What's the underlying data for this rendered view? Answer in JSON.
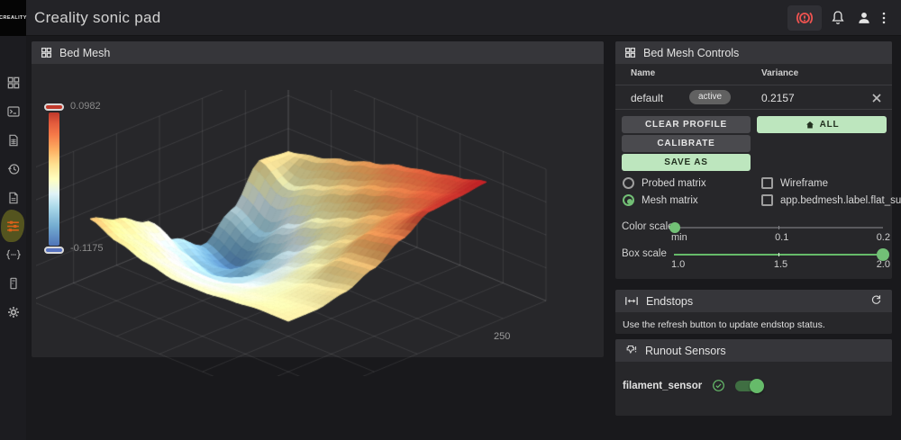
{
  "topbar": {
    "logo_text": "CREALITY",
    "title": "Creality sonic pad",
    "icons": [
      "emergency-stop",
      "notifications-bell",
      "user-account",
      "overflow-menu"
    ]
  },
  "sidebar": {
    "items": [
      {
        "icon": "dashboard-icon"
      },
      {
        "icon": "console-icon"
      },
      {
        "icon": "gcode-files-icon"
      },
      {
        "icon": "history-icon"
      },
      {
        "icon": "configuration-icon"
      },
      {
        "icon": "tune-icon",
        "selected": true
      },
      {
        "icon": "macros-icon"
      },
      {
        "icon": "machine-icon"
      },
      {
        "icon": "settings-gear-icon"
      }
    ]
  },
  "bed_mesh": {
    "title": "Bed Mesh",
    "colorbar_max": "0.0982",
    "colorbar_min": "-0.1175",
    "x_tick": "250"
  },
  "controls": {
    "title": "Bed Mesh Controls",
    "table": {
      "name_header": "Name",
      "variance_header": "Variance",
      "row": {
        "name": "default",
        "badge": "active",
        "variance": "0.2157",
        "close_icon": "close-x"
      }
    },
    "buttons": {
      "clear_profile": "CLEAR PROFILE",
      "all": "ALL",
      "calibrate": "CALIBRATE",
      "save_as": "SAVE AS"
    },
    "radios": [
      {
        "label": "Probed matrix",
        "selected": false
      },
      {
        "label": "Mesh matrix",
        "selected": true
      }
    ],
    "checkboxes": [
      {
        "label": "Wireframe",
        "checked": false
      },
      {
        "label": "app.bedmesh.label.flat_surface",
        "checked": false
      }
    ],
    "sliders": [
      {
        "label": "Color scale",
        "ticks": [
          "min",
          "0.1",
          "0.2"
        ],
        "thumb_position": "left"
      },
      {
        "label": "Box scale",
        "ticks": [
          "1.0",
          "1.5",
          "2.0"
        ],
        "thumb_position": "right"
      }
    ]
  },
  "endstops": {
    "title": "Endstops",
    "message": "Use the refresh button to update endstop status."
  },
  "runout": {
    "title": "Runout Sensors",
    "sensor_name": "filament_sensor",
    "enabled": true
  },
  "colors": {
    "accent_green": "#66bb6a",
    "button_green": "#bde6be",
    "alert_red": "#ef5350",
    "panel_header": "#36363a",
    "panel_body": "#27272a",
    "page_bg": "#19191c",
    "highlight_olive": "#5e5e20",
    "tune_orange": "#d9601a"
  },
  "chart_data": {
    "type": "surface",
    "title": "Bed Mesh",
    "z_min": -0.1175,
    "z_max": 0.0982,
    "x_tick_labels": [
      "250"
    ],
    "colormap": "RdYlBu reversed (blue=low, red=high)",
    "mesh": [
      [
        0.01,
        0.02,
        0.035,
        0.05,
        0.065,
        0.075,
        0.085,
        0.098
      ],
      [
        0.015,
        -0.015,
        0.005,
        0.025,
        0.045,
        0.06,
        0.075,
        0.092
      ],
      [
        -0.05,
        -0.075,
        -0.04,
        -0.01,
        0.01,
        0.035,
        0.06,
        0.088
      ],
      [
        -0.09,
        -0.11,
        -0.08,
        -0.045,
        -0.015,
        0.015,
        0.05,
        0.06
      ],
      [
        -0.06,
        -0.085,
        -0.095,
        -0.06,
        -0.03,
        -0.005,
        0.025,
        0.03
      ],
      [
        -0.01,
        -0.04,
        -0.06,
        -0.055,
        -0.035,
        -0.015,
        0.0,
        0.01
      ],
      [
        0.015,
        -0.005,
        -0.025,
        -0.03,
        -0.025,
        -0.015,
        -0.005,
        0.0
      ],
      [
        0.035,
        0.015,
        0.0,
        -0.01,
        -0.01,
        -0.005,
        0.0,
        0.0
      ]
    ]
  }
}
